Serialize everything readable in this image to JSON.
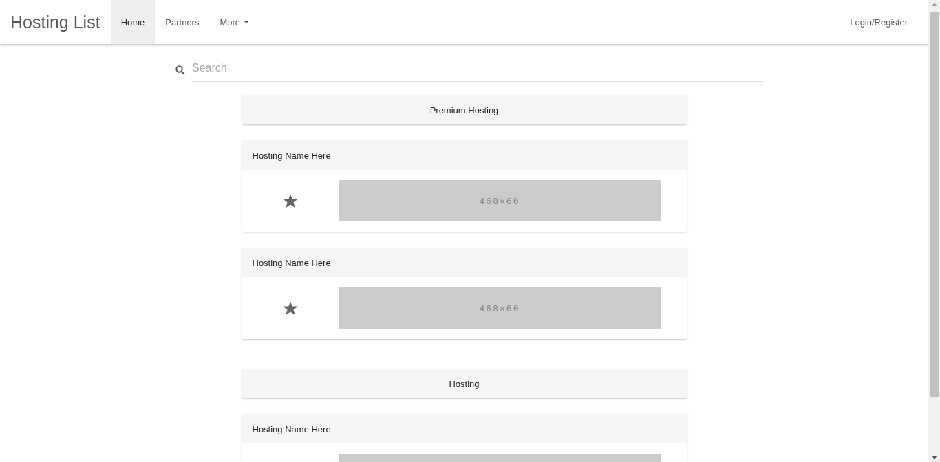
{
  "navbar": {
    "brand": "Hosting List",
    "tabs": [
      {
        "label": "Home",
        "selected": true,
        "dropdown": false
      },
      {
        "label": "Partners",
        "selected": false,
        "dropdown": false
      },
      {
        "label": "More",
        "selected": false,
        "dropdown": true
      }
    ],
    "login": "Login/Register"
  },
  "search": {
    "placeholder": "Search"
  },
  "sections": [
    {
      "title": "Premium Hosting",
      "listings": [
        {
          "name": "Hosting Name Here",
          "star": true,
          "banner": "468×60"
        },
        {
          "name": "Hosting Name Here",
          "star": true,
          "banner": "468×60"
        }
      ]
    },
    {
      "title": "Hosting",
      "listings": [
        {
          "name": "Hosting Name Here"
        }
      ]
    }
  ]
}
